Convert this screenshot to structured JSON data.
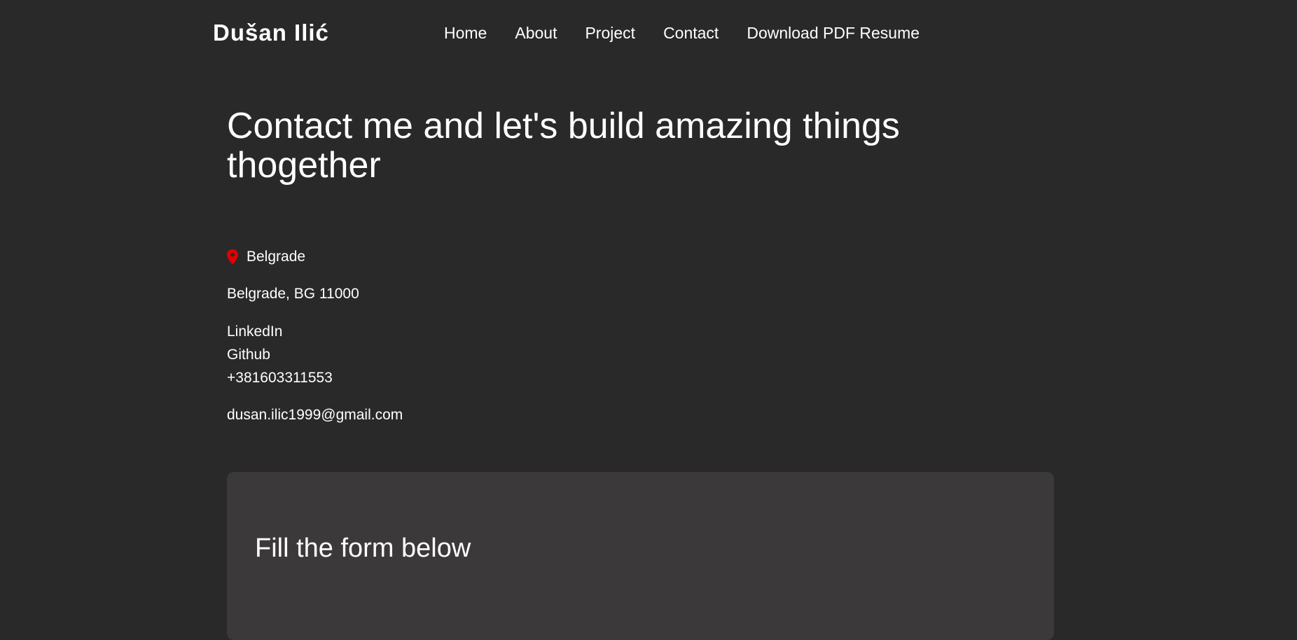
{
  "brand": {
    "name": "Dušan Ilić"
  },
  "nav": {
    "items": [
      {
        "label": "Home"
      },
      {
        "label": "About"
      },
      {
        "label": "Project"
      },
      {
        "label": "Contact"
      },
      {
        "label": "Download PDF Resume"
      }
    ]
  },
  "hero": {
    "headline": "Contact me and let's build amazing things thogether"
  },
  "contact": {
    "location_icon": "map-pin-icon",
    "location_icon_color": "#e30000",
    "city": "Belgrade",
    "address": "Belgrade, BG 11000",
    "linkedin_label": "LinkedIn",
    "github_label": "Github",
    "phone": "+381603311553",
    "email": "dusan.ilic1999@gmail.com"
  },
  "form": {
    "title": "Fill the form below"
  },
  "colors": {
    "background": "#292929",
    "card": "#3b393a",
    "text": "#ffffff"
  }
}
